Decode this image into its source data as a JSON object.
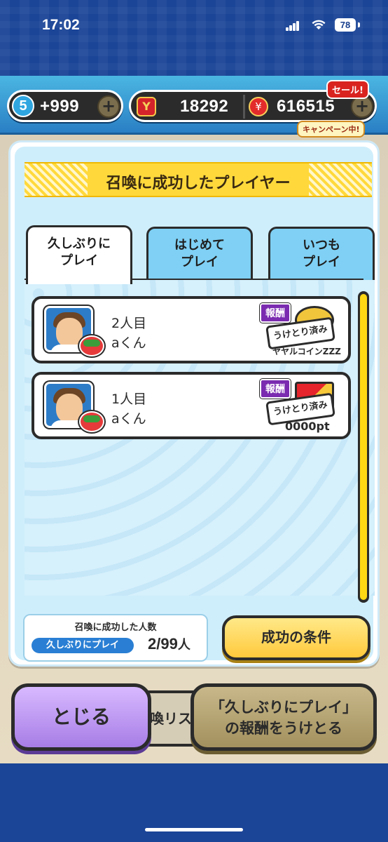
{
  "status_bar": {
    "time": "17:02",
    "battery": "78"
  },
  "currency": {
    "stamina_level": "5",
    "stamina_value": "+999",
    "plus_label": "+",
    "y_money_icon": "Y",
    "y_money_value": "18292",
    "coin_icon": "¥",
    "coin_value": "616515",
    "sale_label": "セール!",
    "campaign_label": "キャンペーン中!"
  },
  "modal": {
    "title": "召喚に成功したプレイヤー",
    "tabs": [
      {
        "line1": "久しぶりに",
        "line2": "プレイ",
        "active": true
      },
      {
        "line1": "はじめて",
        "line2": "プレイ",
        "active": false
      },
      {
        "line1": "いつも",
        "line2": "プレイ",
        "active": false
      }
    ],
    "rows": [
      {
        "count": "2人目",
        "name": "aくん",
        "reward_label": "報酬",
        "received": "うけとり済み",
        "reward_caption": "ヤヤルコインZZZ"
      },
      {
        "count": "1人目",
        "name": "aくん",
        "reward_label": "報酬",
        "received": "うけとり済み",
        "reward_caption": "0000pt"
      }
    ],
    "count_panel": {
      "title": "召喚に成功した人数",
      "tag": "久しぶりにプレイ",
      "value": "2/99",
      "unit": "人"
    },
    "conditions_button": "成功の条件"
  },
  "bottom": {
    "close_button": "とじる",
    "summon_list_button": "喚リス",
    "reward_button_line1": "「久しぶりにプレイ」",
    "reward_button_line2": "の報酬をうけとる"
  },
  "colors": {
    "accent_yellow": "#ffd93b",
    "tab_blue": "#7fd0f4",
    "close_purple": "#b98ef0",
    "background_blue": "#1b4597"
  }
}
